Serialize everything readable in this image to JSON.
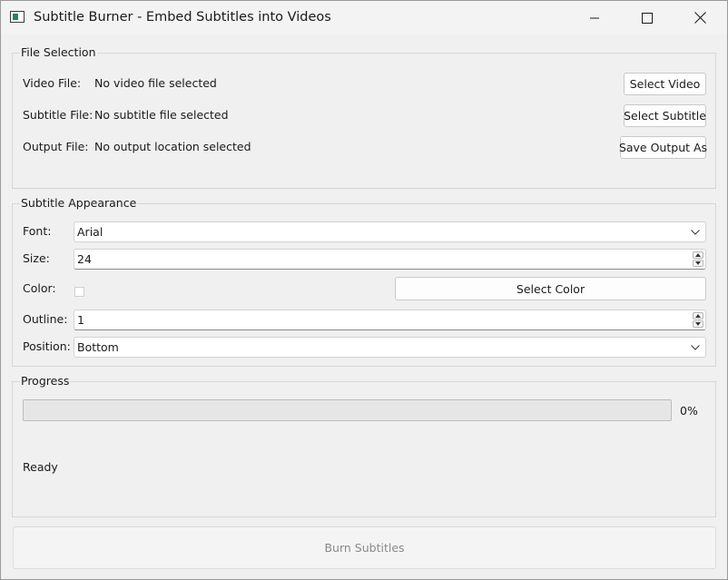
{
  "window": {
    "title": "Subtitle Burner - Embed Subtitles into Videos"
  },
  "file_selection": {
    "title": "File Selection",
    "rows": [
      {
        "label": "Video File:",
        "value": "No video file selected",
        "button": "Select Video"
      },
      {
        "label": "Subtitle File:",
        "value": "No subtitle file selected",
        "button": "Select Subtitle"
      },
      {
        "label": "Output File:",
        "value": "No output location selected",
        "button": "Save Output As"
      }
    ]
  },
  "appearance": {
    "title": "Subtitle Appearance",
    "font_label": "Font:",
    "font_value": "Arial",
    "size_label": "Size:",
    "size_value": "24",
    "color_label": "Color:",
    "color_value": "#ffffff",
    "color_button": "Select Color",
    "outline_label": "Outline:",
    "outline_value": "1",
    "position_label": "Position:",
    "position_value": "Bottom"
  },
  "progress": {
    "title": "Progress",
    "percent_text": "0%",
    "value_fraction": 0,
    "status": "Ready"
  },
  "actions": {
    "burn_label": "Burn Subtitles"
  },
  "icons": {
    "app": "app-icon",
    "minimize": "minimize-icon",
    "maximize": "maximize-icon",
    "close": "close-icon",
    "combo": "chevron-down-icon",
    "spin_up": "spin-up-icon",
    "spin_down": "spin-down-icon"
  }
}
